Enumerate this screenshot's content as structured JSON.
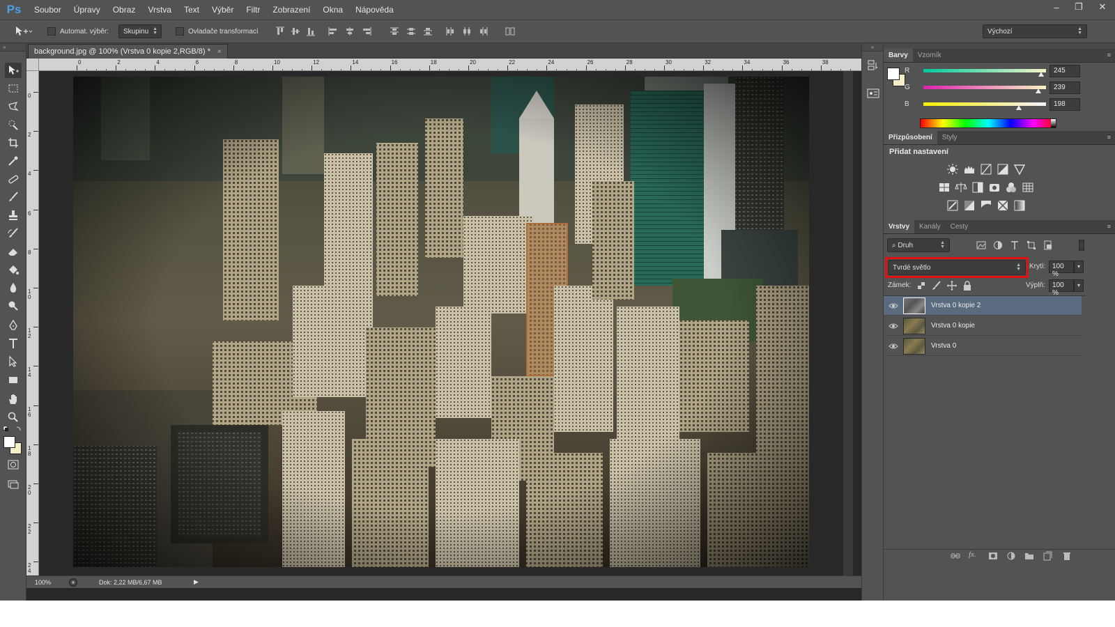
{
  "app": {
    "logo": "Ps"
  },
  "menu": [
    "Soubor",
    "Úpravy",
    "Obraz",
    "Vrstva",
    "Text",
    "Výběr",
    "Filtr",
    "Zobrazení",
    "Okna",
    "Nápověda"
  ],
  "window_controls": {
    "minimize": "–",
    "restore": "❐",
    "close": "✕"
  },
  "options_bar": {
    "auto_select_label": "Automat. výběr:",
    "auto_select_value": "Skupinu",
    "transform_controls_label": "Ovladače transformací",
    "workspace_value": "Výchozí"
  },
  "document": {
    "tab_title": "background.jpg @ 100% (Vrstva 0 kopie 2,RGB/8) *",
    "tab_close": "×",
    "ruler_h_labels": [
      "0",
      "2",
      "4",
      "6",
      "8",
      "10",
      "12",
      "14",
      "16",
      "18",
      "20",
      "22",
      "24",
      "26",
      "28",
      "30",
      "32",
      "34",
      "36",
      "38"
    ],
    "ruler_v_labels": [
      "0",
      "2",
      "4",
      "6",
      "8",
      "1 0",
      "1 2",
      "1 4",
      "1 6",
      "1 8",
      "2 0",
      "2 2",
      "2 4"
    ],
    "zoom": "100%",
    "doc_info": "Dok: 2,22 MB/6,67 MB"
  },
  "color_panel": {
    "tabs": [
      "Barvy",
      "Vzorník"
    ],
    "channels": [
      {
        "label": "R",
        "value": "245",
        "fraction": 0.961,
        "color_from": "#00c8a0",
        "color_to": "#f5f5c6"
      },
      {
        "label": "G",
        "value": "239",
        "fraction": 0.937,
        "color_from": "#e020b0",
        "color_to": "#f5f5c6"
      },
      {
        "label": "B",
        "value": "198",
        "fraction": 0.776,
        "color_from": "#f5ef00",
        "color_to": "#f5efff"
      }
    ],
    "foreground": "#ffffff",
    "background": "#f5efc6"
  },
  "adjustments_panel": {
    "tabs": [
      "Přizpůsobení",
      "Styly"
    ],
    "heading": "Přidat nastavení",
    "icons_row1": [
      "brightness-icon",
      "levels-icon",
      "curves-icon",
      "exposure-icon",
      "vibrance-icon"
    ],
    "icons_row2": [
      "hue-saturation-icon",
      "color-balance-icon",
      "black-white-icon",
      "photo-filter-icon",
      "channel-mixer-icon",
      "color-lookup-icon"
    ],
    "icons_row3": [
      "invert-icon",
      "posterize-icon",
      "threshold-icon",
      "selective-color-icon",
      "gradient-map-icon"
    ]
  },
  "layers_panel": {
    "tabs": [
      "Vrstvy",
      "Kanály",
      "Cesty"
    ],
    "filter_kind": "Druh",
    "blend_mode": "Tvrdé světlo",
    "opacity_label": "Krytí:",
    "opacity_value": "100 %",
    "lock_label": "Zámek:",
    "fill_label": "Výplň:",
    "fill_value": "100 %",
    "layers": [
      {
        "name": "Vrstva 0 kopie 2",
        "selected": true
      },
      {
        "name": "Vrstva 0 kopie",
        "selected": false
      },
      {
        "name": "Vrstva 0",
        "selected": false
      }
    ]
  },
  "colors": {
    "highlight": "#e01010",
    "selected_layer": "#5b6b7f",
    "ps_blue": "#4a9fe8"
  }
}
